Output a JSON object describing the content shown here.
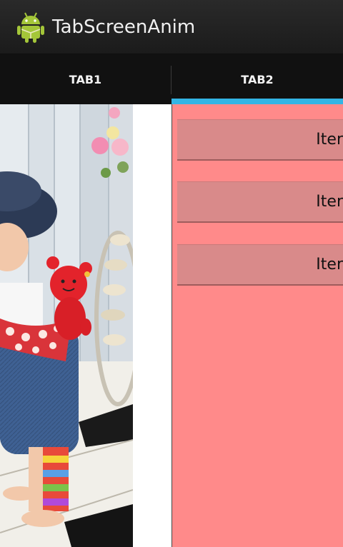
{
  "action_bar": {
    "title": "TabScreenAnim",
    "icon": "android-robot-icon"
  },
  "tabs": [
    {
      "label": "TAB1",
      "selected": false
    },
    {
      "label": "TAB2",
      "selected": true
    }
  ],
  "colors": {
    "accent": "#33b5e5",
    "panel": "#ff8a8a",
    "item_button": "#d98a8a",
    "action_bar": "#222222",
    "tab_strip": "#111111"
  },
  "list": {
    "items": [
      {
        "label": "Iter"
      },
      {
        "label": "Iter"
      },
      {
        "label": "Iter"
      }
    ]
  }
}
